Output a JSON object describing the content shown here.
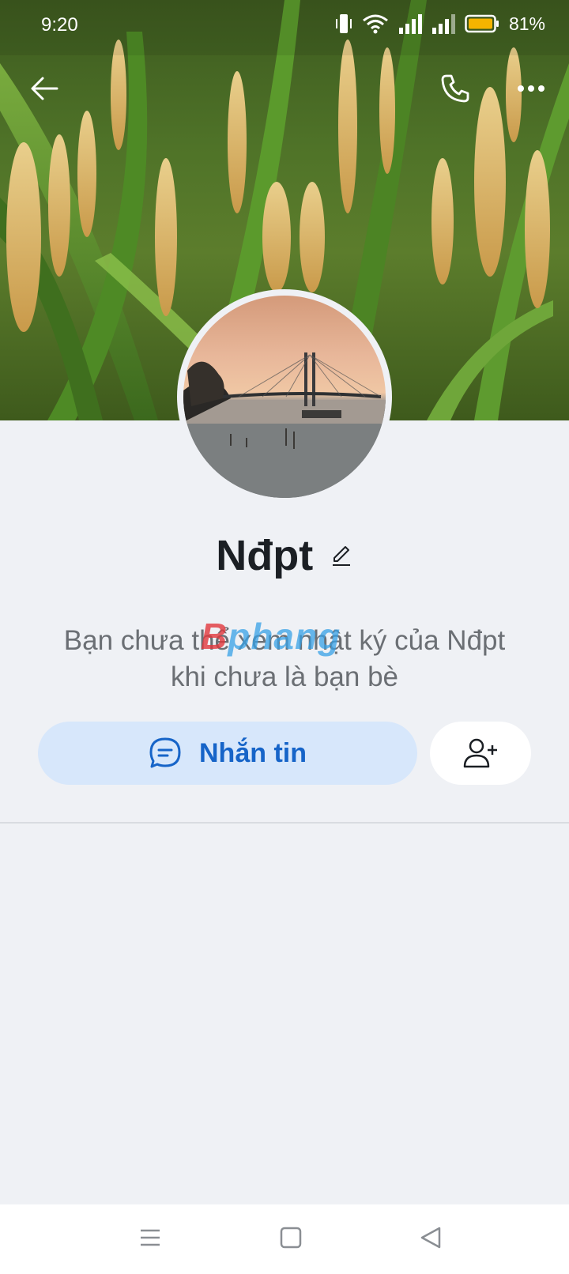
{
  "status_bar": {
    "time": "9:20",
    "battery": "81%"
  },
  "icons": {
    "back": "arrow-left-icon",
    "phone": "phone-icon",
    "more": "more-dots-icon",
    "edit": "pencil-icon",
    "message": "chat-bubble-icon",
    "add_friend": "add-friend-icon",
    "nav_menu": "menu-icon",
    "nav_home": "home-icon",
    "nav_back": "back-triangle-icon"
  },
  "profile": {
    "name": "Nđpt"
  },
  "notice": {
    "line1": "Bạn chưa thể xem nhật ký của Nđpt",
    "line2": "khi chưa là bạn bè"
  },
  "watermark": {
    "part1": "B",
    "part2": "phang"
  },
  "actions": {
    "message_label": "Nhắn tin"
  },
  "colors": {
    "accent": "#1664c8",
    "button_bg": "#d7e7fb",
    "page_bg": "#eff1f5"
  }
}
